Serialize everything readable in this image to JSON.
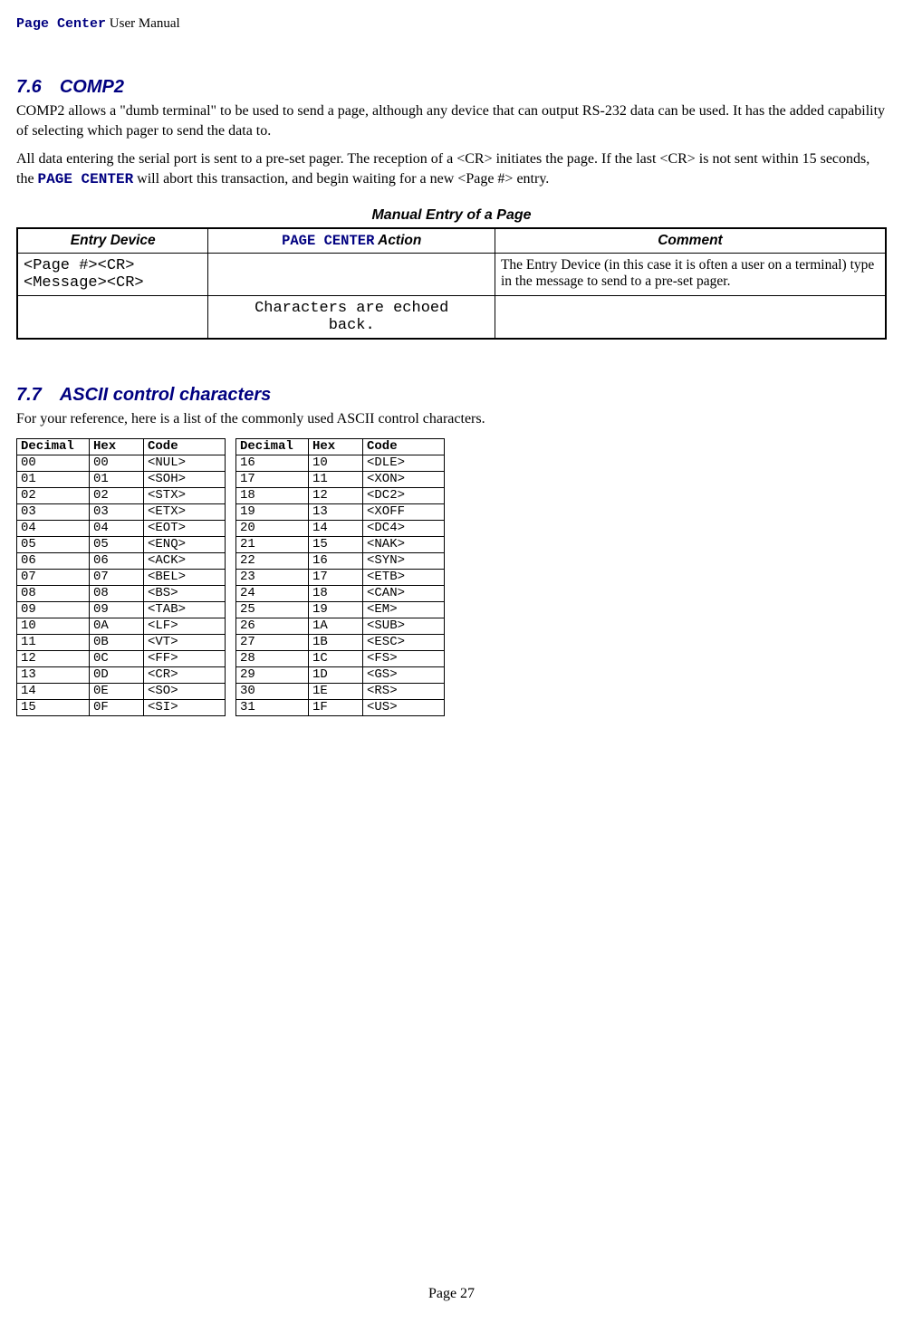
{
  "header": {
    "product": "Page Center",
    "suffix": " User Manual"
  },
  "section76": {
    "num": "7.6",
    "title": "COMP2",
    "para1": "COMP2 allows a \"dumb terminal\" to be used to send a page, although any device that can output RS-232 data can be used.  It has the added capability of selecting which pager to send the data to.",
    "para2a": "All data entering the serial port is sent to a pre-set pager.  The reception of a <CR> initiates the page.  If the last <CR> is not sent within 15 seconds, the ",
    "para2_pc": "PAGE CENTER",
    "para2b": " will abort this transaction, and begin waiting for a new <Page #> entry."
  },
  "entryTable": {
    "caption": "Manual Entry of a Page",
    "headers": {
      "col1": "Entry Device",
      "col2_pc": "PAGE CENTER",
      "col2_rest": " Action",
      "col3": "Comment"
    },
    "row1": {
      "entry_line1": "<Page #><CR>",
      "entry_line2": "<Message><CR>",
      "action": "",
      "comment": "The Entry Device (in this case it is often a user on a terminal) type in the message to send to a pre-set pager."
    },
    "row2": {
      "entry": "",
      "action_line1": "Characters are echoed",
      "action_line2": "back.",
      "comment": ""
    }
  },
  "section77": {
    "num": "7.7",
    "title": "ASCII control characters",
    "intro": "For your reference, here is a list of the commonly used ASCII control characters."
  },
  "asciiHeaders": {
    "dec": "Decimal",
    "hex": "Hex",
    "code": "Code"
  },
  "asciiLeft": [
    {
      "d": "00",
      "h": "00",
      "c": "<NUL>"
    },
    {
      "d": "01",
      "h": "01",
      "c": "<SOH>"
    },
    {
      "d": "02",
      "h": "02",
      "c": "<STX>"
    },
    {
      "d": "03",
      "h": "03",
      "c": "<ETX>"
    },
    {
      "d": "04",
      "h": "04",
      "c": "<EOT>"
    },
    {
      "d": "05",
      "h": "05",
      "c": "<ENQ>"
    },
    {
      "d": "06",
      "h": "06",
      "c": "<ACK>"
    },
    {
      "d": "07",
      "h": "07",
      "c": "<BEL>"
    },
    {
      "d": "08",
      "h": "08",
      "c": "<BS>"
    },
    {
      "d": "09",
      "h": "09",
      "c": "<TAB>"
    },
    {
      "d": "10",
      "h": "0A",
      "c": "<LF>"
    },
    {
      "d": "11",
      "h": "0B",
      "c": "<VT>"
    },
    {
      "d": "12",
      "h": "0C",
      "c": "<FF>"
    },
    {
      "d": "13",
      "h": "0D",
      "c": "<CR>"
    },
    {
      "d": "14",
      "h": "0E",
      "c": "<SO>"
    },
    {
      "d": "15",
      "h": "0F",
      "c": "<SI>"
    }
  ],
  "asciiRight": [
    {
      "d": "16",
      "h": "10",
      "c": "<DLE>"
    },
    {
      "d": "17",
      "h": "11",
      "c": "<XON>"
    },
    {
      "d": "18",
      "h": "12",
      "c": "<DC2>"
    },
    {
      "d": "19",
      "h": "13",
      "c": "<XOFF"
    },
    {
      "d": "20",
      "h": "14",
      "c": "<DC4>"
    },
    {
      "d": "21",
      "h": "15",
      "c": "<NAK>"
    },
    {
      "d": "22",
      "h": "16",
      "c": "<SYN>"
    },
    {
      "d": "23",
      "h": "17",
      "c": "<ETB>"
    },
    {
      "d": "24",
      "h": "18",
      "c": "<CAN>"
    },
    {
      "d": "25",
      "h": "19",
      "c": "<EM>"
    },
    {
      "d": "26",
      "h": "1A",
      "c": "<SUB>"
    },
    {
      "d": "27",
      "h": "1B",
      "c": "<ESC>"
    },
    {
      "d": "28",
      "h": "1C",
      "c": "<FS>"
    },
    {
      "d": "29",
      "h": "1D",
      "c": "<GS>"
    },
    {
      "d": "30",
      "h": "1E",
      "c": "<RS>"
    },
    {
      "d": "31",
      "h": "1F",
      "c": "<US>"
    }
  ],
  "footer": {
    "text": "Page 27"
  }
}
